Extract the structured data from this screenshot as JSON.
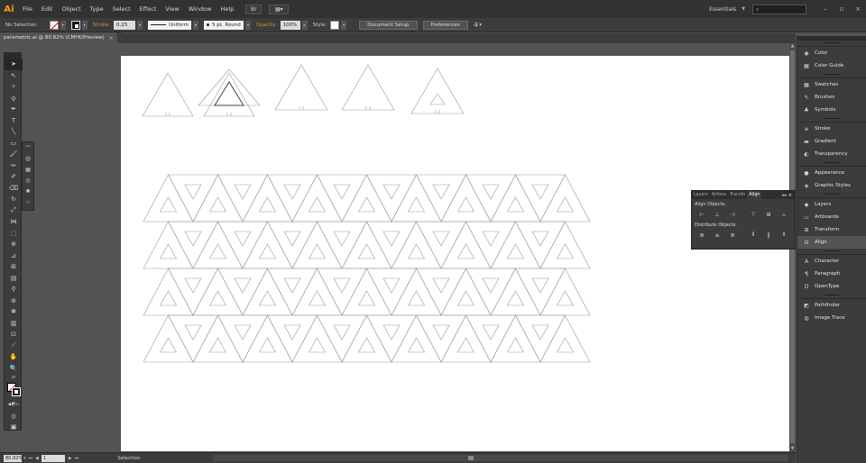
{
  "app": {
    "logo": "Ai"
  },
  "menu": [
    "File",
    "Edit",
    "Object",
    "Type",
    "Select",
    "Effect",
    "View",
    "Window",
    "Help"
  ],
  "bridge_icon": "Br",
  "workspace": {
    "label": "Essentials",
    "search_placeholder": ""
  },
  "window_controls": [
    "–",
    "▫",
    "×"
  ],
  "control_bar": {
    "selection": "No Selection",
    "stroke_label": "Stroke:",
    "stroke_weight": "0.25 pt",
    "profile": "Uniform",
    "brush": "5 pt. Round",
    "opacity_label": "Opacity:",
    "opacity_value": "100%",
    "style_label": "Style:",
    "document_setup": "Document Setup",
    "preferences": "Preferences"
  },
  "document_tab": {
    "title": "parametric.ai @ 80.82% (CMYK/Preview)",
    "close": "×"
  },
  "status_bar": {
    "zoom": "80.82%",
    "page": "1",
    "tool": "Selection"
  },
  "dock": [
    {
      "group": 1,
      "items": [
        {
          "label": "Color",
          "icon": "color-icon",
          "glyph": "◉"
        },
        {
          "label": "Color Guide",
          "icon": "color-guide-icon",
          "glyph": "▦"
        }
      ]
    },
    {
      "group": 2,
      "items": [
        {
          "label": "Swatches",
          "icon": "swatches-icon",
          "glyph": "▦"
        },
        {
          "label": "Brushes",
          "icon": "brushes-icon",
          "glyph": "✎"
        },
        {
          "label": "Symbols",
          "icon": "symbols-icon",
          "glyph": "♣"
        }
      ]
    },
    {
      "group": 3,
      "items": [
        {
          "label": "Stroke",
          "icon": "stroke-icon",
          "glyph": "≡"
        },
        {
          "label": "Gradient",
          "icon": "gradient-icon",
          "glyph": "▬"
        },
        {
          "label": "Transparency",
          "icon": "transparency-icon",
          "glyph": "◐"
        }
      ]
    },
    {
      "group": 4,
      "items": [
        {
          "label": "Appearance",
          "icon": "appearance-icon",
          "glyph": "●"
        },
        {
          "label": "Graphic Styles",
          "icon": "graphic-styles-icon",
          "glyph": "◈"
        }
      ]
    },
    {
      "group": 5,
      "items": [
        {
          "label": "Layers",
          "icon": "layers-icon",
          "glyph": "◆"
        },
        {
          "label": "Artboards",
          "icon": "artboards-icon",
          "glyph": "▭"
        },
        {
          "label": "Transform",
          "icon": "transform-icon",
          "glyph": "⊞"
        },
        {
          "label": "Align",
          "icon": "align-icon",
          "glyph": "⊟"
        }
      ]
    },
    {
      "group": 6,
      "items": [
        {
          "label": "Character",
          "icon": "character-icon",
          "glyph": "A"
        },
        {
          "label": "Paragraph",
          "icon": "paragraph-icon",
          "glyph": "¶"
        },
        {
          "label": "OpenType",
          "icon": "opentype-icon",
          "glyph": "O"
        }
      ]
    },
    {
      "group": 7,
      "items": [
        {
          "label": "Pathfinder",
          "icon": "pathfinder-icon",
          "glyph": "◩"
        },
        {
          "label": "Image Trace",
          "icon": "image-trace-icon",
          "glyph": "◍"
        }
      ]
    }
  ],
  "dock_active": "Align",
  "align_panel": {
    "tabs": [
      "Layers",
      "Artboa",
      "Transfo",
      "Align"
    ],
    "active_tab": "Align",
    "align_objects_label": "Align Objects:",
    "distribute_objects_label": "Distribute Objects:"
  }
}
